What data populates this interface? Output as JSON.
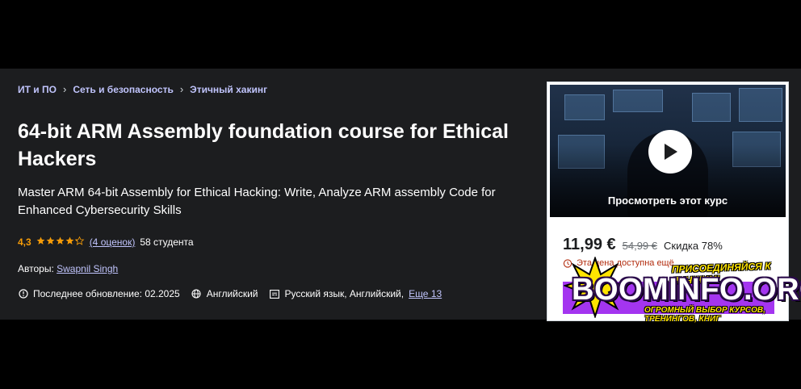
{
  "breadcrumb": {
    "items": [
      "ИТ и ПО",
      "Сеть и безопасность",
      "Этичный хакинг"
    ],
    "separator": "›"
  },
  "course": {
    "title": "64-bit ARM Assembly foundation course for Ethical Hackers",
    "subtitle": "Master ARM 64-bit Assembly for Ethical Hacking: Write, Analyze ARM assembly Code for Enhanced Cybersecurity Skills",
    "rating": "4,3",
    "stars_value": 4.3,
    "rating_count_link": "(4 оценок)",
    "students": "58 студента",
    "authors_label": "Авторы:",
    "author_name": "Swapnil Singh",
    "last_updated": "Последнее обновление: 02.2025",
    "language": "Английский",
    "captions": "Русский язык, Английский,",
    "more_captions_link": "Еще 13"
  },
  "sidebar": {
    "preview_label": "Просмотреть этот курс",
    "price": "11,99 €",
    "old_price": "54,99 €",
    "discount": "Скидка 78%",
    "timer_text": "Эта цена доступна ещё"
  },
  "watermark": {
    "tagline": "ПРИСОЕДИНЯЙСЯ К ЛУЧШИМ!",
    "logo": "BOOMINFO.ORG",
    "sub": "ОГРОМНЫЙ ВЫБОР КУРСОВ, ТРЕНИНГОВ, КНИГ"
  },
  "colors": {
    "background": "#1c1d1f",
    "accent_link": "#c0c4fc",
    "star": "#f69c08",
    "buy_button": "#a435f0",
    "watermark_yellow": "#ffe400"
  },
  "icons": {
    "breadcrumb_separator": "chevron-right-icon",
    "update": "alert-clock-icon",
    "language": "globe-icon",
    "captions": "closed-captions-icon",
    "play": "play-icon",
    "timer": "alarm-clock-icon"
  }
}
